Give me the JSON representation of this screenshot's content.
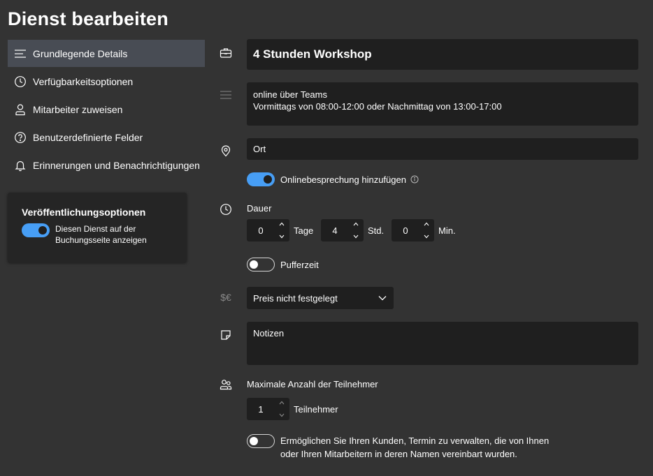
{
  "page": {
    "title": "Dienst bearbeiten"
  },
  "nav": {
    "items": [
      {
        "label": "Grundlegende Details",
        "icon": "lines-icon"
      },
      {
        "label": "Verfügbarkeitsoptionen",
        "icon": "clock-icon"
      },
      {
        "label": "Mitarbeiter zuweisen",
        "icon": "person-icon"
      },
      {
        "label": "Benutzerdefinierte Felder",
        "icon": "question-icon"
      },
      {
        "label": "Erinnerungen und Benachrichtigungen",
        "icon": "bell-icon"
      }
    ]
  },
  "publish": {
    "title": "Veröffentlichungsoptionen",
    "toggle_label": "Diesen Dienst auf der Buchungsseite anzeigen",
    "toggle_on": true
  },
  "form": {
    "service_name": "4 Stunden Workshop",
    "description_line1": "online über Teams",
    "description_line2": "Vormittags von 08:00-12:00 oder Nachmittag von 13:00-17:00",
    "location_placeholder": "Ort",
    "online_meeting_label": "Onlinebesprechung hinzufügen",
    "online_meeting_on": true,
    "duration_label": "Dauer",
    "duration": {
      "days": "0",
      "days_unit": "Tage",
      "hours": "4",
      "hours_unit": "Std.",
      "minutes": "0",
      "minutes_unit": "Min."
    },
    "buffer_label": "Pufferzeit",
    "buffer_on": false,
    "price_icon_text": "$€",
    "price_value": "Preis nicht festgelegt",
    "notes_placeholder": "Notizen",
    "max_attendees_label": "Maximale Anzahl der Teilnehmer",
    "max_attendees_value": "1",
    "max_attendees_unit": "Teilnehmer",
    "manage_label_line1": "Ermöglichen Sie Ihren Kunden, Termin zu verwalten, die von Ihnen",
    "manage_label_line2": "oder Ihren Mitarbeitern in deren Namen vereinbart wurden.",
    "manage_on": false
  },
  "colors": {
    "background": "#333333",
    "field": "#1f1f1f",
    "accent": "#479ef5",
    "nav_active": "#484c54"
  }
}
